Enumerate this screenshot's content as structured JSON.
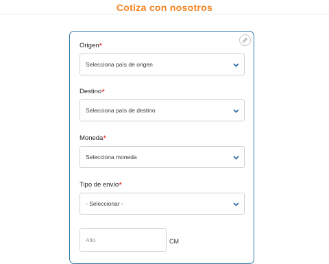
{
  "page_title": "Cotiza con nosotros",
  "colors": {
    "accent": "#f58220",
    "card_border": "#2f7aa8",
    "chevron": "#2e6da4",
    "required": "#e0231c"
  },
  "icons": {
    "edit": "pencil-icon",
    "dropdown": "chevron-down-icon"
  },
  "form": {
    "required_mark": "*",
    "origen": {
      "label": "Origen",
      "selected": "Selecciona país de origen"
    },
    "destino": {
      "label": "Destino",
      "selected": "Selecciona país de destino"
    },
    "moneda": {
      "label": "Moneda",
      "selected": "Selecciona moneda"
    },
    "tipo_envio": {
      "label": "Tipo de envío",
      "selected": "- Seleccionar -"
    },
    "alto": {
      "placeholder": "Alto",
      "unit": "CM"
    }
  }
}
